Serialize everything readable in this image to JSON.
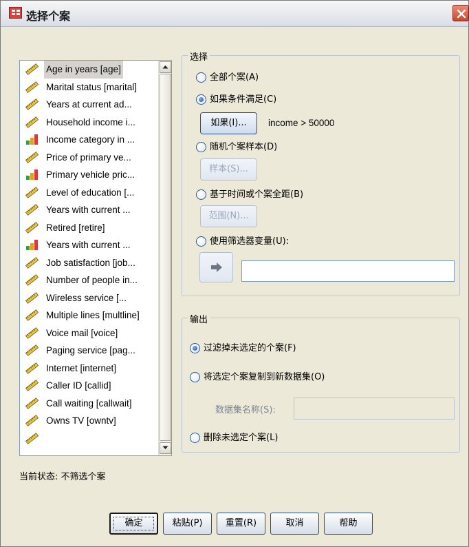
{
  "window": {
    "title": "选择个案"
  },
  "variables": [
    {
      "label": "Age in years [age]",
      "type": "scale",
      "selected": true
    },
    {
      "label": "Marital status [marital]",
      "type": "scale"
    },
    {
      "label": "Years at current ad...",
      "type": "scale"
    },
    {
      "label": "Household income i...",
      "type": "scale"
    },
    {
      "label": "Income category in ...",
      "type": "ordinal"
    },
    {
      "label": "Price of primary ve...",
      "type": "scale"
    },
    {
      "label": "Primary vehicle pric...",
      "type": "ordinal"
    },
    {
      "label": "Level of education [...",
      "type": "scale"
    },
    {
      "label": "Years with current ...",
      "type": "scale"
    },
    {
      "label": "Retired [retire]",
      "type": "scale"
    },
    {
      "label": "Years with current ...",
      "type": "ordinal"
    },
    {
      "label": "Job satisfaction [job...",
      "type": "scale"
    },
    {
      "label": "Number of people in...",
      "type": "scale"
    },
    {
      "label": "Wireless service [...",
      "type": "scale"
    },
    {
      "label": "Multiple lines [multline]",
      "type": "scale"
    },
    {
      "label": "Voice mail [voice]",
      "type": "scale"
    },
    {
      "label": "Paging service [pag...",
      "type": "scale"
    },
    {
      "label": "Internet [internet]",
      "type": "scale"
    },
    {
      "label": "Caller ID [callid]",
      "type": "scale"
    },
    {
      "label": "Call waiting [callwait]",
      "type": "scale"
    },
    {
      "label": "Owns TV [owntv]",
      "type": "scale"
    },
    {
      "label": "",
      "type": "scale"
    }
  ],
  "status": "当前状态: 不筛选个案",
  "select_group": {
    "title": "选择",
    "options": {
      "all": "全部个案(A)",
      "if_condition": "如果条件满足(C)",
      "random": "随机个案样本(D)",
      "time_range": "基于时间或个案全距(B)",
      "filter_var": "使用筛选器变量(U):"
    },
    "selected": "if_condition",
    "if_button": "如果(I)...",
    "condition_text": "income > 50000",
    "sample_button": "样本(S)...",
    "range_button": "范围(N)...",
    "filter_value": ""
  },
  "output_group": {
    "title": "输出",
    "options": {
      "filter": "过滤掉未选定的个案(F)",
      "copy": "将选定个案复制到新数据集(O)",
      "delete": "删除未选定个案(L)"
    },
    "selected": "filter",
    "dataset_label": "数据集名称(S):",
    "dataset_value": ""
  },
  "buttons": {
    "ok": "确定",
    "paste": "粘贴(P)",
    "reset": "重置(R)",
    "cancel": "取消",
    "help": "帮助"
  },
  "icons": {
    "app": "spss-data-icon",
    "close": "close-icon",
    "scale": "ruler-icon",
    "ordinal": "bar-chart-icon",
    "move": "arrow-right-icon"
  },
  "colors": {
    "dialog_bg": "#ece9d8",
    "group_border": "#bcc4d6",
    "accent": "#2b4a7d",
    "close": "#c64731"
  }
}
